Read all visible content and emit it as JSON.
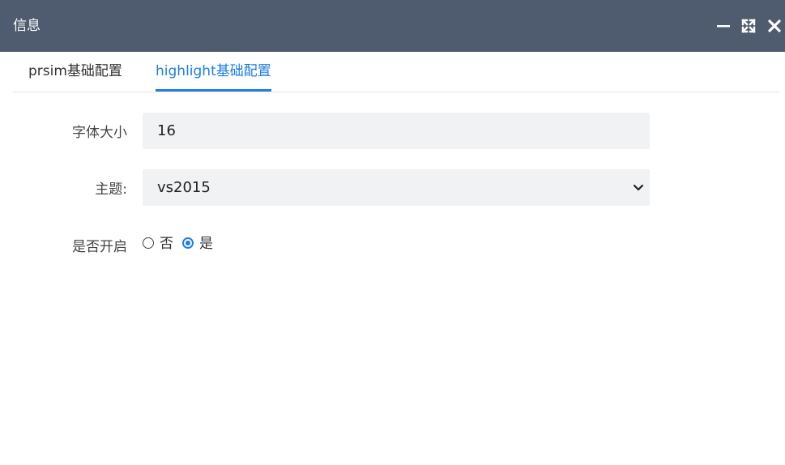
{
  "window": {
    "title": "信息",
    "controls": [
      "minimize-icon",
      "maximize-icon",
      "close-icon"
    ]
  },
  "tabs": [
    {
      "label": "prsim基础配置",
      "active": false
    },
    {
      "label": "highlight基础配置",
      "active": true
    }
  ],
  "form": {
    "font_size": {
      "label": "字体大小",
      "value": "16"
    },
    "theme": {
      "label": "主题:",
      "selected": "vs2015"
    },
    "enabled": {
      "label": "是否开启",
      "options": [
        {
          "label": "否",
          "checked": false
        },
        {
          "label": "是",
          "checked": true
        }
      ]
    }
  },
  "colors": {
    "titlebar": "#4f5b6e",
    "accent": "#1e7ee6",
    "field_bg": "#f1f2f4"
  }
}
